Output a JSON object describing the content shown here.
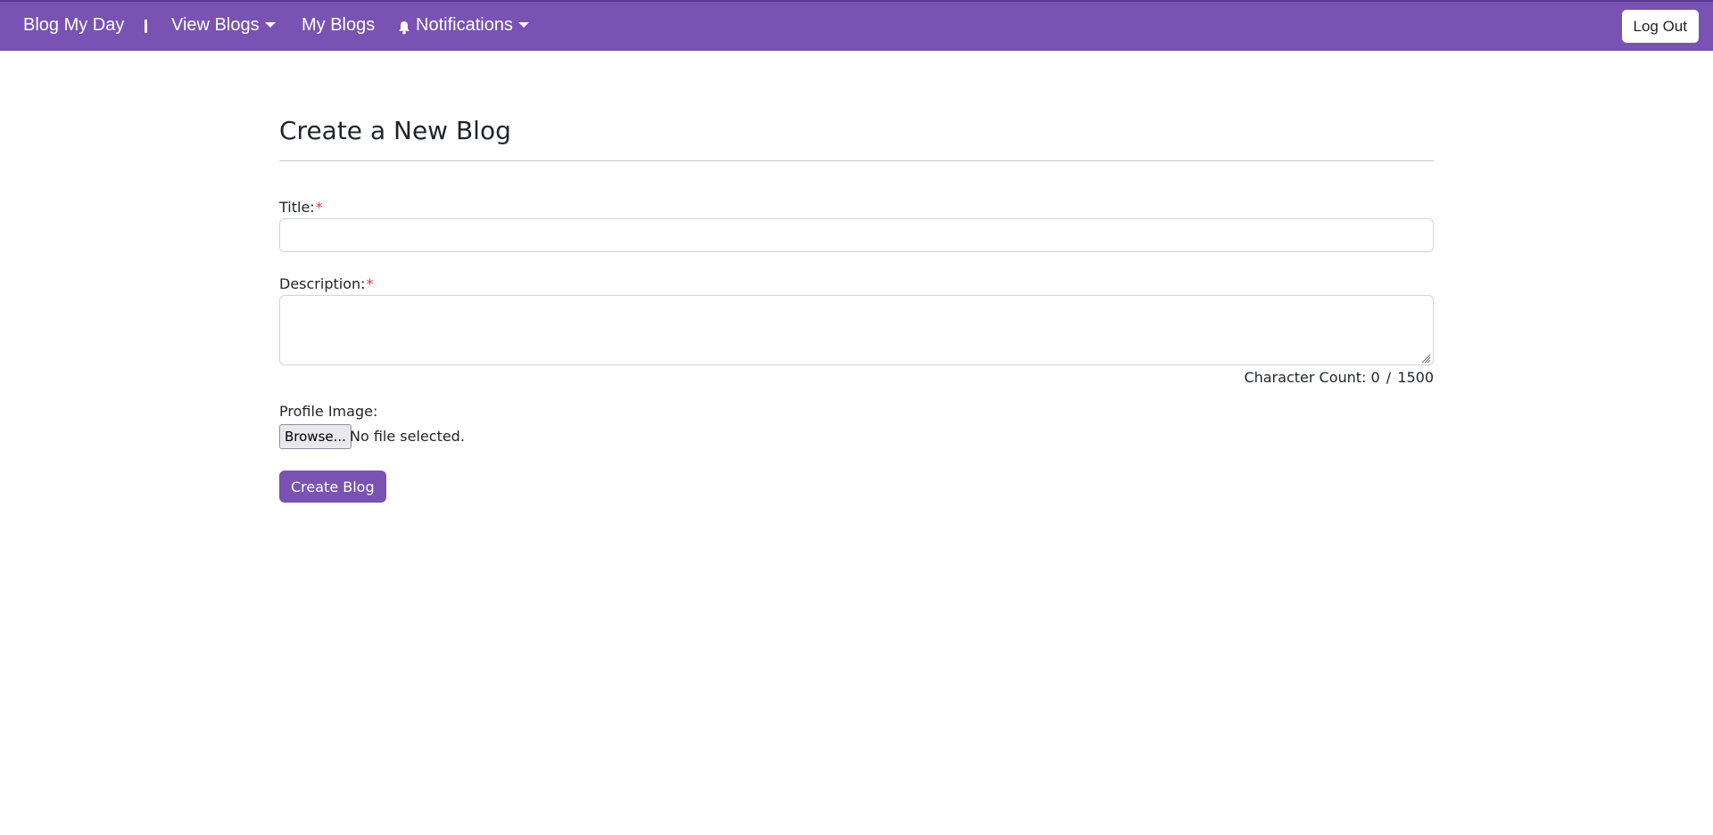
{
  "navbar": {
    "brand": "Blog My Day",
    "view_blogs": "View Blogs",
    "my_blogs": "My Blogs",
    "notifications": "Notifications",
    "logout": "Log Out",
    "background_color": "#7952b3",
    "bell_icon": "bell-icon",
    "caret_icon": "caret-down-icon"
  },
  "form": {
    "heading": "Create a New Blog",
    "title_label": "Title:",
    "title_value": "",
    "description_label": "Description:",
    "description_value": "",
    "required_mark": "*",
    "character_count_label": "Character Count:",
    "character_count_current": "0",
    "character_count_separator": "/",
    "character_count_max": "1500",
    "profile_image_label": "Profile Image:",
    "browse_label": "Browse...",
    "file_status": "No file selected.",
    "submit_label": "Create Blog",
    "accent_color": "#7952b3",
    "required_color": "#dc3545"
  }
}
